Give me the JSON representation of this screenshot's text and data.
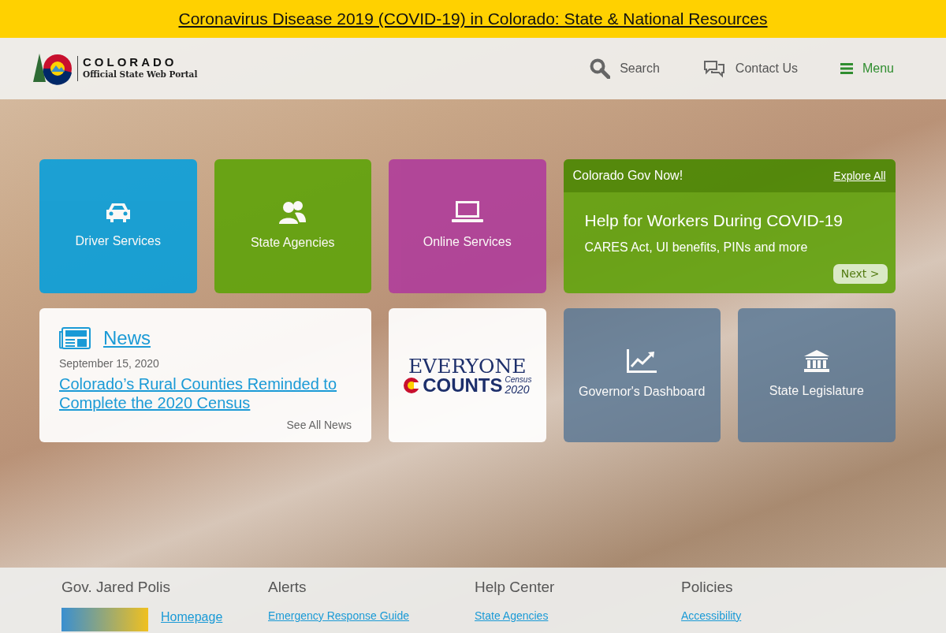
{
  "banner": {
    "text": "Coronavirus Disease 2019 (COVID-19) in Colorado: State & National Resources"
  },
  "header": {
    "logo": {
      "title": "COLORADO",
      "subtitle": "Official State Web Portal"
    },
    "nav": [
      {
        "kind": "search",
        "label": "Search"
      },
      {
        "kind": "contact",
        "label": "Contact Us"
      },
      {
        "kind": "menu",
        "label": "Menu"
      }
    ]
  },
  "tiles": [
    {
      "kind": "car",
      "label": "Driver Services",
      "color": "#0e9fd8"
    },
    {
      "kind": "people",
      "label": "State Agencies",
      "color": "#62a30d"
    },
    {
      "kind": "laptop",
      "label": "Online Services",
      "color": "#b0409a"
    }
  ],
  "feature": {
    "heading": "Colorado Gov Now!",
    "link": "Explore All",
    "title": "Help for Workers During COVID-19",
    "subtitle": "CARES Act, UI benefits, PINs and more",
    "button": "Next >"
  },
  "news": {
    "heading": "News",
    "date": "September 15, 2020",
    "headline": "Colorado’s Rural Counties Reminded to Complete the 2020 Census",
    "more": "See All News"
  },
  "census": {
    "line1": "EVERYONE",
    "line2": "COUNTS",
    "tag": "Census",
    "year": "2020"
  },
  "links": [
    {
      "kind": "chart",
      "label": "Governor's Dashboard"
    },
    {
      "kind": "capitol",
      "label": "State Legislature"
    }
  ],
  "footer": [
    {
      "heading": "Gov. Jared Polis",
      "photo": true,
      "links": [
        "Homepage"
      ]
    },
    {
      "heading": "Alerts",
      "links": [
        "Emergency Response Guide"
      ]
    },
    {
      "heading": "Help Center",
      "links": [
        "State Agencies"
      ]
    },
    {
      "heading": "Policies",
      "links": [
        "Accessibility"
      ]
    }
  ]
}
